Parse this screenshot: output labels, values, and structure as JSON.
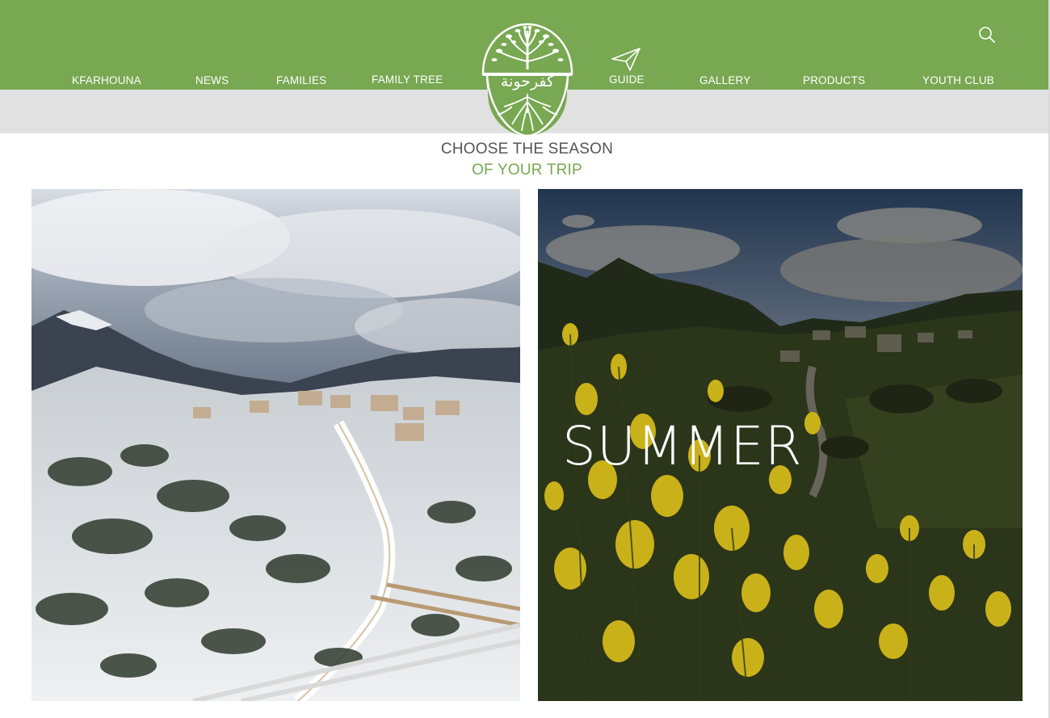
{
  "nav": {
    "items": [
      {
        "label": "KFARHOUNA"
      },
      {
        "label": "NEWS"
      },
      {
        "label": "FAMILIES"
      },
      {
        "label": "FAMILY TREE"
      },
      {
        "label": "GUIDE"
      },
      {
        "label": "GALLERY"
      },
      {
        "label": "PRODUCTS"
      },
      {
        "label": "YOUTH CLUB"
      }
    ],
    "search_icon": "search-icon",
    "guide_icon": "navigation-arrow-icon"
  },
  "logo": {
    "label": "كفرحونة",
    "icon": "tree-with-roots"
  },
  "heading": {
    "line1": "CHOOSE THE SEASON",
    "line2": "OF YOUR TRIP"
  },
  "seasons": [
    {
      "label": "",
      "image": "snowy mountain village"
    },
    {
      "label": "SUMMER",
      "image": "yellow broom flowers over green valley"
    }
  ],
  "colors": {
    "brand_green": "#78a852",
    "band_grey": "#e1e1e1",
    "heading_grey": "#555555"
  }
}
